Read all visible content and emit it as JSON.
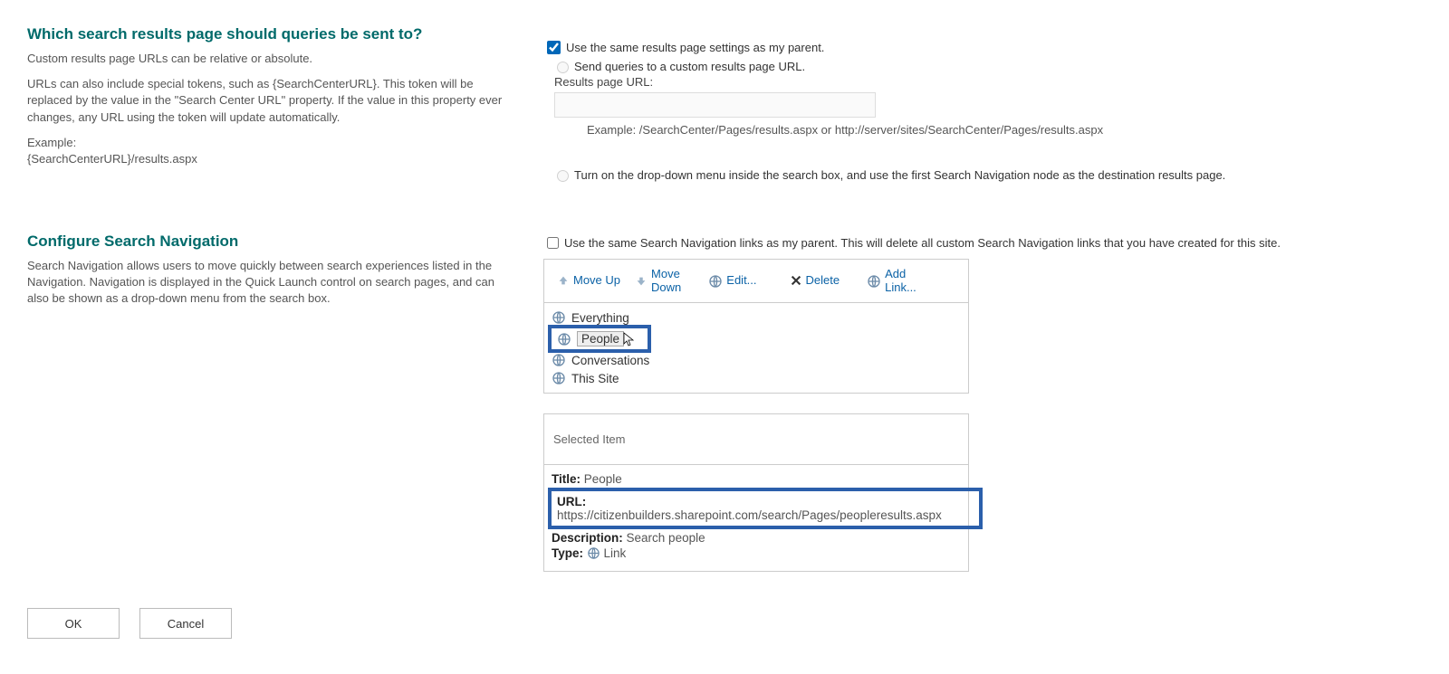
{
  "section_results": {
    "heading": "Which search results page should queries be sent to?",
    "p1": "Custom results page URLs can be relative or absolute.",
    "p2": "URLs can also include special tokens, such as {SearchCenterURL}. This token will be replaced by the value in the \"Search Center URL\" property. If the value in this property ever changes, any URL using the token will update automatically.",
    "p3a": "Example:",
    "p3b": "{SearchCenterURL}/results.aspx",
    "cb_same_parent": "Use the same results page settings as my parent.",
    "rb_custom": "Send queries to a custom results page URL.",
    "url_label": "Results page URL:",
    "example": "Example: /SearchCenter/Pages/results.aspx or http://server/sites/SearchCenter/Pages/results.aspx",
    "rb_dropdown": "Turn on the drop-down menu inside the search box, and use the first Search Navigation node as the destination results page."
  },
  "section_nav": {
    "heading": "Configure Search Navigation",
    "p1": "Search Navigation allows users to move quickly between search experiences listed in the Navigation. Navigation is displayed in the Quick Launch control on search pages, and can also be shown as a drop-down menu from the search box.",
    "cb_same_parent": "Use the same Search Navigation links as my parent. This will delete all custom Search Navigation links that you have created for this site.",
    "toolbar": {
      "moveup": "Move Up",
      "movedown_a": "Move",
      "movedown_b": "Down",
      "edit": "Edit...",
      "delete": "Delete",
      "addlink_a": "Add",
      "addlink_b": "Link..."
    },
    "items": [
      "Everything",
      "People",
      "Conversations",
      "This Site"
    ]
  },
  "selected": {
    "header": "Selected Item",
    "title_k": "Title:",
    "title_v": "People",
    "url_k": "URL:",
    "url_v": "https://citizenbuilders.sharepoint.com/search/Pages/peopleresults.aspx",
    "desc_k": "Description:",
    "desc_v": "Search people",
    "type_k": "Type:",
    "type_v": "Link"
  },
  "buttons": {
    "ok": "OK",
    "cancel": "Cancel"
  }
}
